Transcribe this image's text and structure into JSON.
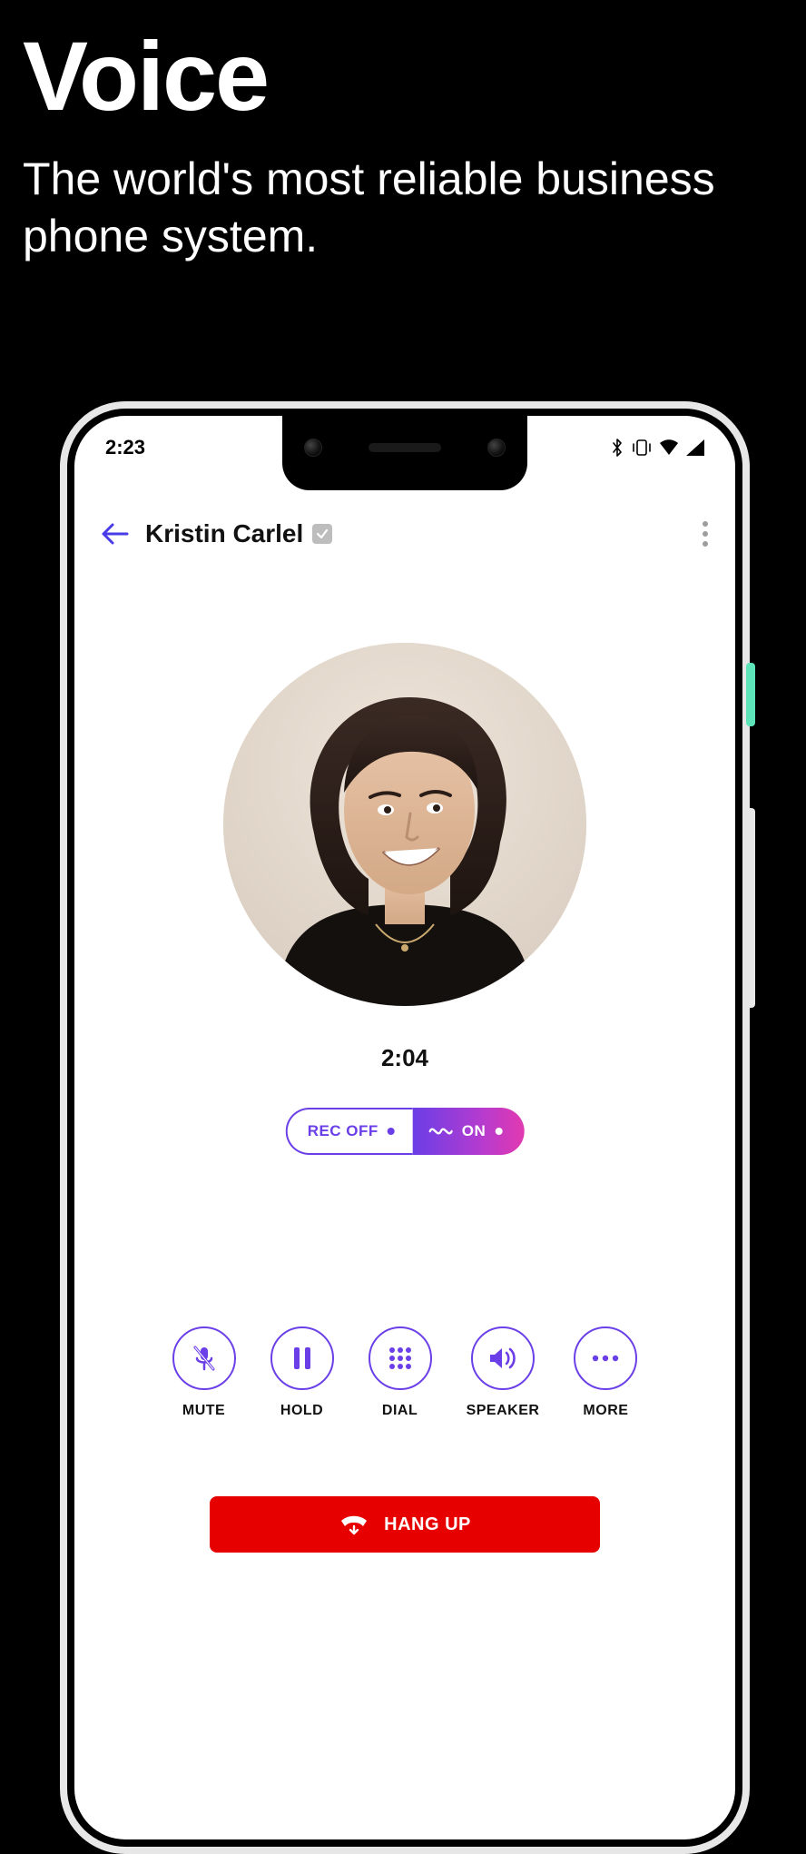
{
  "promo": {
    "title": "Voice",
    "subtitle": "The world's most reliable business phone system."
  },
  "statusbar": {
    "time": "2:23",
    "icons": {
      "bluetooth": "bluetooth-icon",
      "vibrate": "vibrate-icon",
      "wifi": "wifi-icon",
      "signal": "signal-icon"
    }
  },
  "header": {
    "contact_name": "Kristin Carlel",
    "verified": true
  },
  "call": {
    "duration": "2:04"
  },
  "toggle": {
    "off_label": "REC OFF",
    "on_label": "ON"
  },
  "actions": {
    "mute": "MUTE",
    "hold": "HOLD",
    "dial": "DIAL",
    "speaker": "SPEAKER",
    "more": "MORE"
  },
  "hangup": {
    "label": "HANG UP"
  },
  "colors": {
    "accent": "#6b3fe8",
    "danger": "#e60000",
    "gradient_start": "#6a3ee6",
    "gradient_end": "#e23ab0"
  }
}
